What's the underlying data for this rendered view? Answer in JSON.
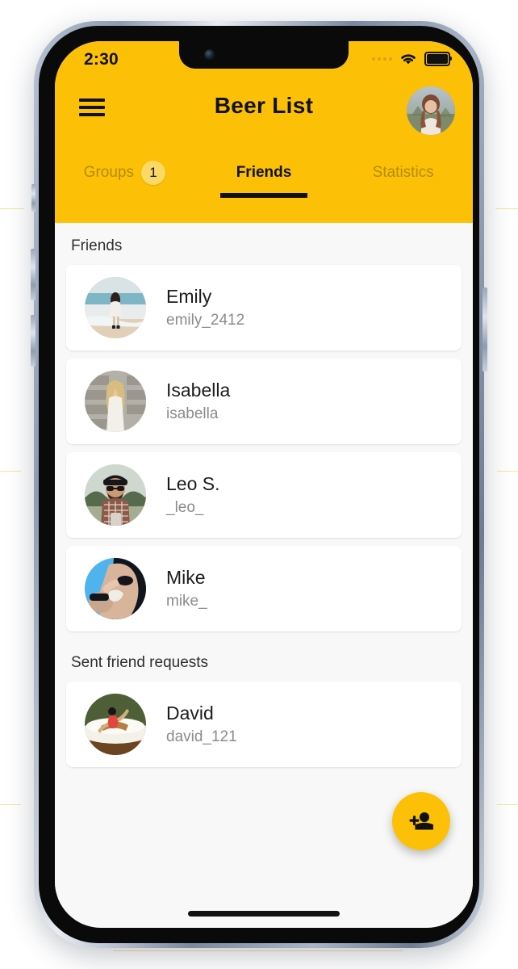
{
  "status_bar": {
    "time": "2:30",
    "icons": [
      "signal-dots-icon",
      "wifi-icon",
      "battery-icon"
    ]
  },
  "app_bar": {
    "menu_icon": "hamburger-menu-icon",
    "title": "Beer List",
    "avatar": "profile-avatar"
  },
  "tabs": [
    {
      "label": "Groups",
      "badge": "1",
      "active": false
    },
    {
      "label": "Friends",
      "badge": null,
      "active": true
    },
    {
      "label": "Statistics",
      "badge": null,
      "active": false
    }
  ],
  "sections": [
    {
      "title": "Friends",
      "items": [
        {
          "name": "Emily",
          "username": "emily_2412",
          "avatar": "emily-avatar"
        },
        {
          "name": "Isabella",
          "username": "isabella",
          "avatar": "isabella-avatar"
        },
        {
          "name": "Leo S.",
          "username": "_leo_",
          "avatar": "leo-avatar"
        },
        {
          "name": "Mike",
          "username": "mike_",
          "avatar": "mike-avatar"
        }
      ]
    },
    {
      "title": "Sent friend requests",
      "items": [
        {
          "name": "David",
          "username": "david_121",
          "avatar": "david-avatar"
        }
      ]
    }
  ],
  "fab": {
    "icon": "person-add-icon",
    "label": "Add friend"
  },
  "colors": {
    "brand_yellow": "#FCC107",
    "badge_yellow": "#FAD967",
    "content_bg": "#f8f8f8",
    "card_bg": "#ffffff",
    "primary_text": "#1c1c1c",
    "secondary_text": "#8b8b8b"
  }
}
